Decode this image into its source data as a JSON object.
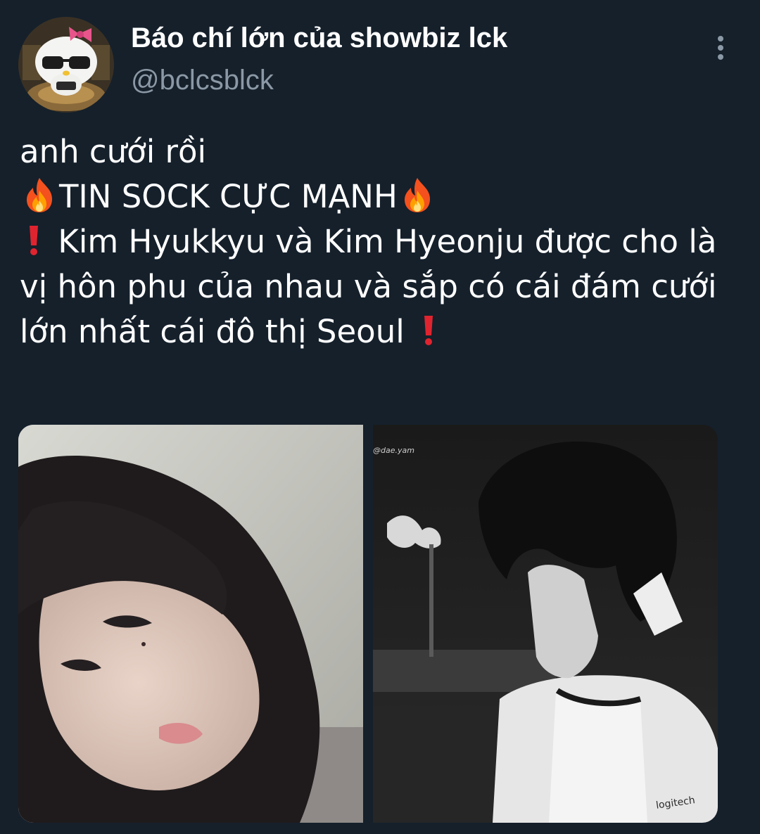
{
  "author": {
    "display_name": "Báo chí lớn của showbiz lck",
    "handle": "@bclcsblck",
    "avatar_icon": "hello-kitty-sunglasses-avatar"
  },
  "menu": {
    "more_icon": "vertical-ellipsis-icon"
  },
  "tweet": {
    "line1": "anh cưới rồi",
    "line2": "TIN SOCK CỰC MẠNH",
    "line3": "Kim Hyukkyu và Kim Hyeonju được cho là vị hôn phu của nhau và sắp có cái đám cưới lớn nhất cái đô thị Seoul",
    "emojis": {
      "fire": "fire-emoji",
      "exclamation": "red-exclamation-emoji"
    }
  },
  "media": [
    {
      "kind": "photo",
      "description_icon": "woman-portrait-photo"
    },
    {
      "kind": "photo",
      "description_icon": "man-monochrome-photo",
      "watermark": "@dae.yam",
      "shirt_logo": "logitech"
    }
  ],
  "colors": {
    "background": "#15202b",
    "text_primary": "#ffffff",
    "text_secondary": "#8b98a5",
    "accent_red": "#e0242f"
  }
}
